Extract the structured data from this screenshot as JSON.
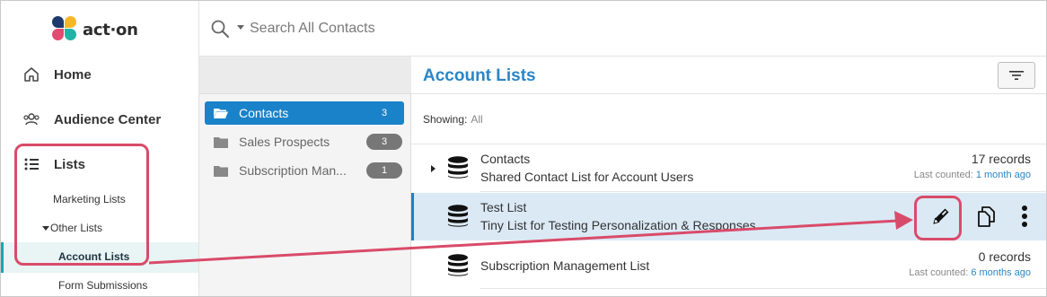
{
  "brand": {
    "name": "act·on"
  },
  "nav": {
    "home": "Home",
    "audience_center": "Audience Center",
    "lists": "Lists",
    "marketing_lists": "Marketing Lists",
    "other_lists": "Other Lists",
    "account_lists": "Account Lists",
    "form_submissions": "Form Submissions"
  },
  "search": {
    "placeholder": "Search All Contacts"
  },
  "folders": [
    {
      "label": "Contacts",
      "count": "3",
      "active": true
    },
    {
      "label": "Sales Prospects",
      "count": "3",
      "active": false
    },
    {
      "label": "Subscription Man...",
      "count": "1",
      "active": false
    }
  ],
  "main": {
    "title": "Account Lists",
    "showing_label": "Showing:",
    "showing_value": "All"
  },
  "lists": [
    {
      "name": "Contacts",
      "description": "Shared Contact List for Account Users",
      "records": "17 records",
      "counted_label": "Last counted:",
      "counted_value": "1 month ago"
    },
    {
      "name": "Test List",
      "description": "Tiny List for Testing Personalization & Responses"
    },
    {
      "name": "Subscription Management List",
      "records": "0 records",
      "counted_label": "Last counted:",
      "counted_value": "6 months ago"
    }
  ],
  "icons": {
    "logo": "act-on-logo-icon",
    "home": "home-icon",
    "audience": "audience-icon",
    "lists": "list-icon",
    "search": "search-icon",
    "filter": "filter-icon",
    "folder": "folder-icon",
    "database": "database-icon",
    "edit": "pencil-icon",
    "duplicate": "duplicate-icon",
    "more": "more-vertical-icon"
  },
  "colors": {
    "accent": "#1a82c9",
    "title_blue": "#2b86c5",
    "teal": "#19a7a8",
    "annotation": "#d94b6a",
    "selected_row": "#dbe9f5"
  }
}
